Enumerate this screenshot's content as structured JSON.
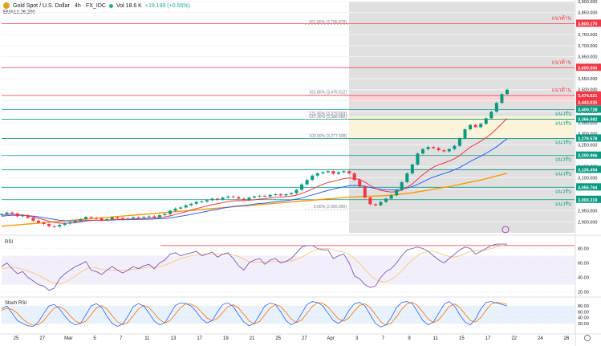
{
  "header": {
    "title": "Gold Spot / U.S. Dollar · 4h · FX_IDC",
    "volume": "Vol 18.6 K",
    "change": "+19.189 (+0.56%)",
    "ema_label": "EMA12,26,200"
  },
  "chart_data": {
    "type": "line",
    "ylim": [
      2850,
      3900
    ],
    "y_ticks": [
      3900,
      3850,
      3750,
      3700,
      3650,
      3550,
      3500,
      3450,
      3400,
      3350,
      3300,
      3250,
      3150,
      3100,
      3050,
      2950,
      2900
    ],
    "x_labels": [
      "25",
      "27",
      "Mar",
      "5",
      "7",
      "11",
      "13",
      "17",
      "19",
      "21",
      "25",
      "27",
      "Apr",
      "3",
      "7",
      "9",
      "11",
      "15",
      "17",
      "22",
      "24",
      "26"
    ],
    "price_close": [
      2935,
      2942,
      2938,
      2925,
      2930,
      2918,
      2905,
      2896,
      2890,
      2880,
      2878,
      2886,
      2892,
      2898,
      2905,
      2912,
      2922,
      2918,
      2915,
      2908,
      2912,
      2920,
      2917,
      2912,
      2915,
      2920,
      2918,
      2922,
      2925,
      2920,
      2930,
      2935,
      2950,
      2960,
      2965,
      2975,
      2982,
      2990,
      2992,
      2998,
      3005,
      3002,
      3010,
      3015,
      3012,
      3005,
      3000,
      3010,
      3015,
      3018,
      3015,
      3022,
      3025,
      3020,
      3025,
      3030,
      3045,
      3070,
      3090,
      3110,
      3120,
      3125,
      3130,
      3118,
      3125,
      3130,
      3120,
      3090,
      3060,
      3010,
      2980,
      2975,
      2990,
      3005,
      3020,
      3045,
      3080,
      3120,
      3160,
      3210,
      3230,
      3240,
      3235,
      3225,
      3220,
      3230,
      3245,
      3280,
      3320,
      3340,
      3330,
      3345,
      3370,
      3400,
      3440,
      3480,
      3500
    ],
    "ema_fast": [
      2930,
      2934,
      2935,
      2932,
      2931,
      2928,
      2922,
      2916,
      2910,
      2903,
      2897,
      2894,
      2893,
      2894,
      2896,
      2899,
      2904,
      2906,
      2907,
      2907,
      2908,
      2910,
      2911,
      2911,
      2911,
      2913,
      2914,
      2915,
      2917,
      2917,
      2919,
      2922,
      2927,
      2933,
      2939,
      2946,
      2953,
      2960,
      2966,
      2972,
      2978,
      2982,
      2987,
      2992,
      2995,
      2996,
      2996,
      2998,
      3000,
      3003,
      3005,
      3008,
      3011,
      3012,
      3014,
      3017,
      3021,
      3029,
      3038,
      3049,
      3060,
      3070,
      3079,
      3084,
      3090,
      3096,
      3099,
      3097,
      3092,
      3080,
      3065,
      3052,
      3043,
      3038,
      3035,
      3037,
      3044,
      3056,
      3072,
      3093,
      3114,
      3133,
      3148,
      3159,
      3167,
      3176,
      3186,
      3201,
      3220,
      3239,
      3252,
      3266,
      3282,
      3300,
      3322,
      3346,
      3370
    ],
    "ema_slow": [
      2925,
      2928,
      2929,
      2929,
      2929,
      2928,
      2926,
      2923,
      2919,
      2915,
      2911,
      2907,
      2905,
      2904,
      2904,
      2904,
      2906,
      2907,
      2907,
      2907,
      2907,
      2908,
      2909,
      2909,
      2910,
      2910,
      2911,
      2911,
      2912,
      2913,
      2914,
      2915,
      2918,
      2921,
      2925,
      2929,
      2934,
      2939,
      2943,
      2948,
      2953,
      2957,
      2962,
      2966,
      2970,
      2972,
      2974,
      2977,
      2980,
      2983,
      2985,
      2988,
      2991,
      2994,
      2996,
      2999,
      3003,
      3008,
      3015,
      3022,
      3029,
      3036,
      3043,
      3048,
      3054,
      3059,
      3064,
      3065,
      3064,
      3061,
      3056,
      3051,
      3048,
      3046,
      3045,
      3045,
      3048,
      3053,
      3060,
      3070,
      3081,
      3093,
      3103,
      3111,
      3119,
      3127,
      3136,
      3147,
      3160,
      3174,
      3186,
      3198,
      3211,
      3225,
      3241,
      3259,
      3277
    ],
    "ema_200": [
      2880,
      2882,
      2884,
      2886,
      2888,
      2890,
      2892,
      2894,
      2896,
      2898,
      2900,
      2902,
      2904,
      2906,
      2908,
      2910,
      2912,
      2914,
      2916,
      2918,
      2920,
      2922,
      2924,
      2926,
      2928,
      2930,
      2932,
      2934,
      2936,
      2938,
      2940,
      2942,
      2944,
      2946,
      2948,
      2950,
      2952,
      2954,
      2956,
      2958,
      2960,
      2962,
      2964,
      2966,
      2968,
      2970,
      2972,
      2974,
      2976,
      2978,
      2980,
      2982,
      2984,
      2986,
      2988,
      2990,
      2992,
      2994,
      2996,
      2998,
      3000,
      3002,
      3004,
      3006,
      3008,
      3010,
      3012,
      3013,
      3014,
      3015,
      3016,
      3017,
      3018,
      3019,
      3021,
      3023,
      3026,
      3029,
      3032,
      3036,
      3040,
      3044,
      3048,
      3052,
      3056,
      3060,
      3065,
      3070,
      3075,
      3080,
      3085,
      3090,
      3096,
      3102,
      3108,
      3114,
      3120
    ],
    "fibonacci": [
      {
        "label": "261.80% (3,796.878)",
        "value": 3796.878
      },
      {
        "label": "161.80% (3,476.912)",
        "value": 3476.912
      },
      {
        "label": "131.40% (3,379.603)",
        "value": 3379.603
      },
      {
        "label": "127.20% (3,366.082)",
        "value": 3366.082
      },
      {
        "label": "100.00% (3,277.508)",
        "value": 3277.508
      },
      {
        "label": "0.00% (2,956.990)",
        "value": 2956.99
      }
    ],
    "levels": [
      {
        "value": 3800.17,
        "label": "3,800.170",
        "tag": "แนวต้าน",
        "kind": "resistance"
      },
      {
        "value": 3600.0,
        "label": "3,600.000",
        "tag": "แนวต้าน",
        "kind": "resistance"
      },
      {
        "value": 3474.021,
        "label": "3,474.021",
        "tag": "แนวต้าน",
        "kind": "resistance"
      },
      {
        "value": 3443.035,
        "label": "3,443.035",
        "tag": "",
        "kind": "price"
      },
      {
        "value": 3409.728,
        "label": "3,409.728",
        "tag": "แนวรับ",
        "kind": "support"
      },
      {
        "value": 3366.082,
        "label": "3,366.082",
        "tag": "แนวรับ",
        "kind": "support"
      },
      {
        "value": 3278.578,
        "label": "3,278.578",
        "tag": "แนวรับ",
        "kind": "support"
      },
      {
        "value": 3200.966,
        "label": "3,200.966",
        "tag": "แนวรับ",
        "kind": "support"
      },
      {
        "value": 3136.494,
        "label": "3,136.494",
        "tag": "แนวรับ",
        "kind": "support"
      },
      {
        "value": 3056.764,
        "label": "3,056.764",
        "tag": "แนวรับ",
        "kind": "support"
      },
      {
        "value": 3000.319,
        "label": "3,000.319",
        "tag": "แนวรับ",
        "kind": "support"
      }
    ],
    "rsi": {
      "label": "RSI",
      "ylim": [
        15,
        95
      ],
      "ticks": [
        80,
        60,
        40,
        20
      ],
      "values": [
        55,
        60,
        52,
        45,
        48,
        40,
        35,
        30,
        28,
        22,
        25,
        38,
        45,
        50,
        55,
        58,
        62,
        50,
        48,
        44,
        50,
        55,
        50,
        46,
        50,
        55,
        52,
        56,
        58,
        52,
        60,
        64,
        72,
        74,
        70,
        72,
        74,
        76,
        70,
        72,
        75,
        68,
        72,
        74,
        66,
        56,
        50,
        60,
        64,
        66,
        58,
        64,
        66,
        60,
        62,
        66,
        74,
        82,
        84,
        84,
        80,
        78,
        78,
        66,
        70,
        72,
        60,
        42,
        38,
        30,
        26,
        28,
        40,
        48,
        52,
        60,
        70,
        78,
        80,
        82,
        80,
        76,
        70,
        64,
        60,
        66,
        72,
        78,
        82,
        80,
        72,
        76,
        80,
        84,
        86,
        86,
        86
      ],
      "signal": [
        52,
        53,
        54,
        53,
        51,
        49,
        46,
        43,
        39,
        35,
        32,
        31,
        33,
        37,
        42,
        47,
        51,
        54,
        53,
        51,
        50,
        50,
        50,
        50,
        50,
        51,
        52,
        53,
        54,
        54,
        55,
        57,
        60,
        63,
        66,
        68,
        70,
        71,
        72,
        72,
        72,
        72,
        72,
        72,
        71,
        69,
        65,
        62,
        61,
        61,
        61,
        62,
        62,
        62,
        62,
        63,
        65,
        68,
        72,
        76,
        79,
        80,
        80,
        78,
        76,
        75,
        72,
        66,
        59,
        51,
        43,
        37,
        34,
        34,
        37,
        42,
        49,
        57,
        64,
        70,
        74,
        76,
        76,
        74,
        71,
        69,
        68,
        70,
        73,
        76,
        77,
        77,
        78,
        80,
        82,
        84,
        85
      ]
    },
    "stoch_rsi": {
      "label": "Stoch RSI",
      "ylim": [
        -5,
        105
      ],
      "ticks": [
        80,
        60,
        40,
        20
      ],
      "k": [
        70,
        80,
        55,
        30,
        20,
        12,
        10,
        25,
        55,
        80,
        85,
        70,
        45,
        25,
        15,
        20,
        50,
        80,
        88,
        75,
        45,
        20,
        10,
        18,
        45,
        78,
        88,
        80,
        55,
        28,
        15,
        22,
        52,
        82,
        90,
        88,
        80,
        60,
        35,
        22,
        30,
        60,
        85,
        90,
        78,
        50,
        25,
        12,
        20,
        50,
        80,
        90,
        85,
        60,
        30,
        15,
        25,
        55,
        85,
        95,
        92,
        80,
        55,
        30,
        20,
        35,
        65,
        88,
        92,
        80,
        50,
        20,
        8,
        15,
        40,
        75,
        92,
        95,
        88,
        60,
        30,
        15,
        25,
        55,
        85,
        95,
        80,
        50,
        25,
        15,
        35,
        70,
        92,
        95,
        90,
        85,
        80
      ],
      "d": [
        65,
        72,
        68,
        55,
        35,
        21,
        14,
        16,
        30,
        53,
        73,
        78,
        67,
        47,
        28,
        20,
        28,
        50,
        73,
        81,
        69,
        47,
        25,
        16,
        24,
        47,
        70,
        82,
        74,
        54,
        33,
        22,
        30,
        52,
        75,
        87,
        86,
        76,
        58,
        39,
        29,
        37,
        58,
        78,
        84,
        73,
        51,
        29,
        19,
        27,
        50,
        73,
        85,
        78,
        58,
        35,
        23,
        32,
        55,
        78,
        91,
        89,
        76,
        55,
        35,
        28,
        40,
        63,
        82,
        87,
        74,
        50,
        26,
        14,
        21,
        43,
        69,
        87,
        92,
        81,
        59,
        35,
        23,
        32,
        55,
        78,
        87,
        75,
        52,
        30,
        25,
        40,
        66,
        86,
        92,
        90,
        85
      ]
    }
  }
}
